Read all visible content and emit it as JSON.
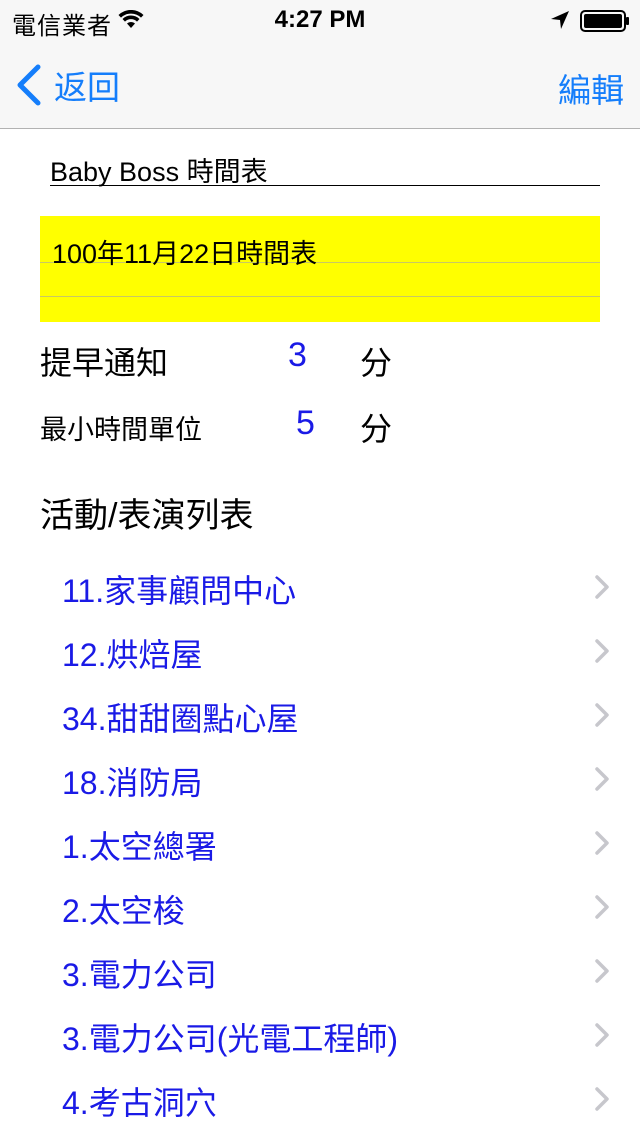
{
  "status_bar": {
    "carrier": "電信業者",
    "time": "4:27 PM"
  },
  "nav": {
    "back_label": "返回",
    "edit_label": "編輯"
  },
  "schedule": {
    "title": "Baby Boss 時間表",
    "note": "100年11月22日時間表",
    "note_color": "#ffff00"
  },
  "settings": {
    "advance_notice_label": "提早通知",
    "advance_notice_value": "3",
    "advance_notice_unit": "分",
    "min_unit_label": "最小時間單位",
    "min_unit_value": "5",
    "min_unit_unit": "分"
  },
  "activities": {
    "section_title": "活動/表演列表",
    "items": [
      "11.家事顧問中心",
      "12.烘焙屋",
      "34.甜甜圈點心屋",
      "18.消防局",
      "1.太空總署",
      "2.太空梭",
      "3.電力公司",
      "3.電力公司(光電工程師)",
      "4.考古洞穴"
    ]
  },
  "colors": {
    "accent": "#157efb",
    "value_blue": "#1a1ae6",
    "chevron": "#c7c7cc"
  }
}
